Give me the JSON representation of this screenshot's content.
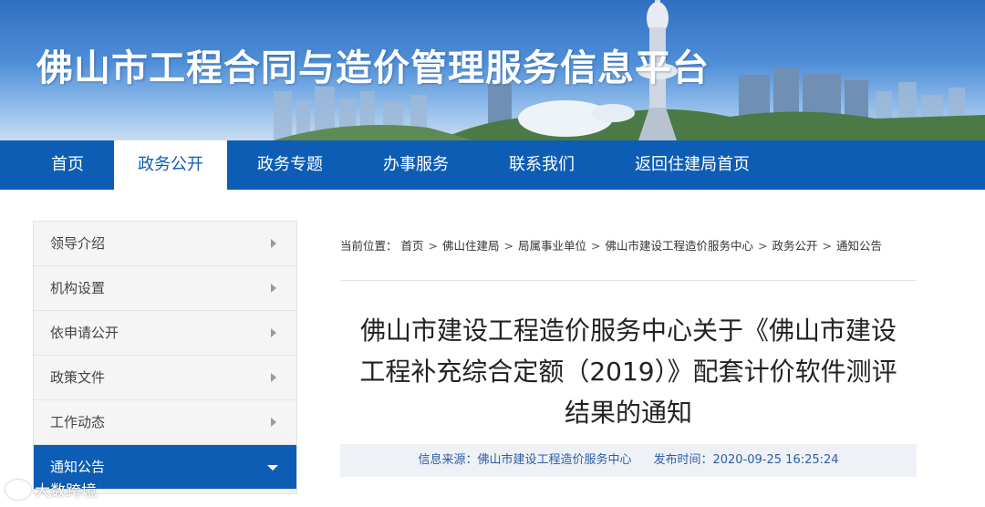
{
  "banner": {
    "title": "佛山市工程合同与造价管理服务信息平台"
  },
  "nav": {
    "items": [
      {
        "label": "首页"
      },
      {
        "label": "政务公开"
      },
      {
        "label": "政务专题"
      },
      {
        "label": "办事服务"
      },
      {
        "label": "联系我们"
      },
      {
        "label": "返回住建局首页"
      }
    ],
    "active_index": 1
  },
  "sidebar": {
    "items": [
      {
        "label": "领导介绍"
      },
      {
        "label": "机构设置"
      },
      {
        "label": "依申请公开"
      },
      {
        "label": "政策文件"
      },
      {
        "label": "工作动态"
      },
      {
        "label": "通知公告"
      }
    ],
    "active_index": 5
  },
  "breadcrumb": {
    "lead": "当前位置：",
    "items": [
      "首页",
      "佛山住建局",
      "局属事业单位",
      "佛山市建设工程造价服务中心",
      "政务公开",
      "通知公告"
    ]
  },
  "article": {
    "title_lines": [
      "佛山市建设工程造价服务中心关于《佛山市建设",
      "工程补充综合定额（2019）》配套计价软件测评",
      "结果的通知"
    ],
    "source_label": "信息来源：",
    "source": "佛山市建设工程造价服务中心",
    "time_label": "发布时间：",
    "time": "2020-09-25 16:25:24"
  },
  "watermark": {
    "text": "大数跨境"
  },
  "colors": {
    "primary": "#0d5db4",
    "meta_bg": "#eef1f6",
    "meta_text": "#2d5ea3"
  }
}
